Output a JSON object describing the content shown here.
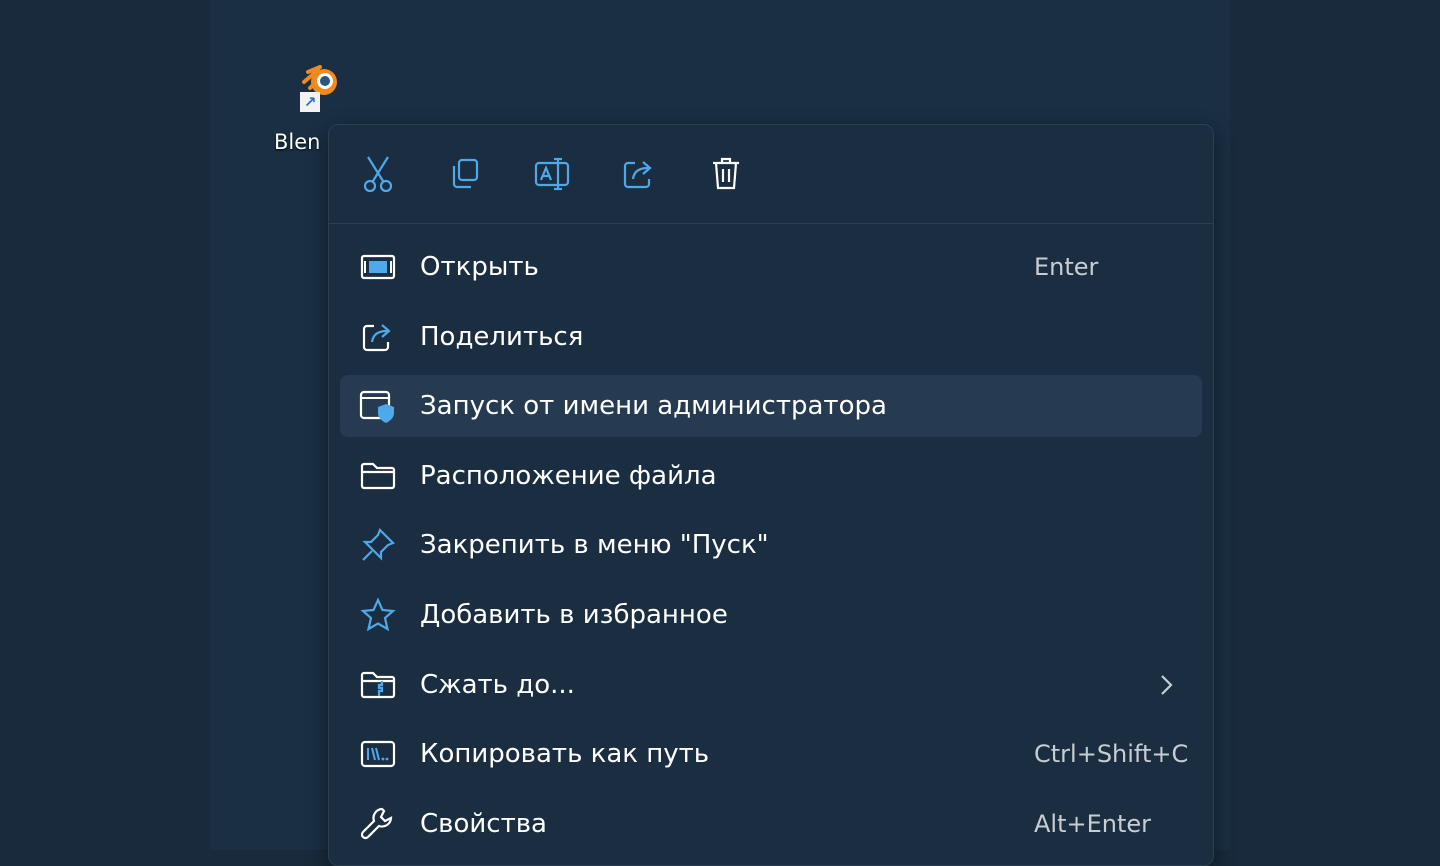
{
  "colors": {
    "background": "#182a3b",
    "menu_background": "#1b2e41",
    "highlight": "#263b51",
    "icon_accent": "#4fa8e8",
    "text": "#ffffff",
    "shortcut_text": "#c8cdd3"
  },
  "desktop": {
    "icon_label": "Blen",
    "icon_name": "blender-shortcut-icon"
  },
  "toolbar": {
    "buttons": [
      {
        "name": "cut-icon"
      },
      {
        "name": "copy-icon"
      },
      {
        "name": "rename-icon"
      },
      {
        "name": "share-icon"
      },
      {
        "name": "delete-icon"
      }
    ]
  },
  "menu": {
    "items": [
      {
        "label": "Открыть",
        "shortcut": "Enter",
        "icon": "open-icon"
      },
      {
        "label": "Поделиться",
        "shortcut": "",
        "icon": "share-icon"
      },
      {
        "label": "Запуск от имени администратора",
        "shortcut": "",
        "icon": "run-as-admin-icon",
        "highlighted": true
      },
      {
        "label": "Расположение файла",
        "shortcut": "",
        "icon": "folder-icon"
      },
      {
        "label": "Закрепить в меню \"Пуск\"",
        "shortcut": "",
        "icon": "pin-icon"
      },
      {
        "label": "Добавить в избранное",
        "shortcut": "",
        "icon": "star-icon"
      },
      {
        "label": "Сжать до...",
        "shortcut": "",
        "icon": "zip-folder-icon",
        "submenu": true
      },
      {
        "label": "Копировать как путь",
        "shortcut": "Ctrl+Shift+C",
        "icon": "copy-path-icon"
      },
      {
        "label": "Свойства",
        "shortcut": "Alt+Enter",
        "icon": "wrench-icon"
      }
    ]
  }
}
